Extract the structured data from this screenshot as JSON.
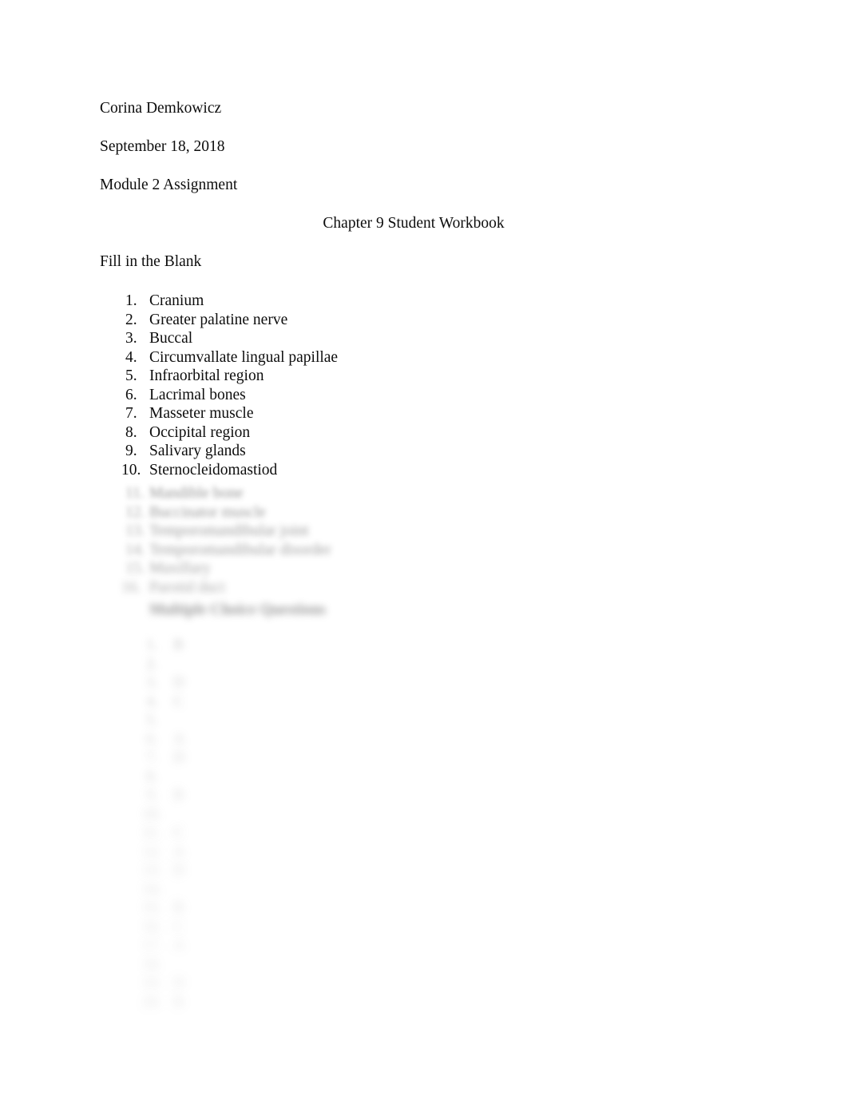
{
  "document": {
    "author": "Corina Demkowicz",
    "date": "September 18, 2018",
    "assignment": "Module 2 Assignment",
    "title": "Chapter 9 Student Workbook"
  },
  "sections": {
    "fill_in_the_blank": {
      "heading": "Fill in the Blank",
      "answers": [
        {
          "num": "1.",
          "text": "Cranium"
        },
        {
          "num": "2.",
          "text": "Greater palatine nerve"
        },
        {
          "num": "3.",
          "text": "Buccal"
        },
        {
          "num": "4.",
          "text": "Circumvallate lingual papillae"
        },
        {
          "num": "5.",
          "text": "Infraorbital region"
        },
        {
          "num": "6.",
          "text": "Lacrimal bones"
        },
        {
          "num": "7.",
          "text": "Masseter muscle"
        },
        {
          "num": "8.",
          "text": "Occipital region"
        },
        {
          "num": "9.",
          "text": "Salivary glands"
        },
        {
          "num": "10.",
          "text": "Sternocleidomastiod"
        }
      ],
      "redacted_answers": [
        {
          "num": "11.",
          "text": "Mandible bone"
        },
        {
          "num": "12.",
          "text": "Buccinator muscle"
        },
        {
          "num": "13.",
          "text": "Temporomandibular joint"
        },
        {
          "num": "14.",
          "text": "Temporomandibular disorder"
        },
        {
          "num": "15.",
          "text": "Maxillary"
        },
        {
          "num": "16.",
          "text": "Parotid duct"
        }
      ]
    },
    "multiple_choice": {
      "heading": "Multiple Choice Questions",
      "redacted_answers": [
        {
          "num": "1.",
          "text": "B"
        },
        {
          "num": "2.",
          "text": ""
        },
        {
          "num": "3.",
          "text": "D"
        },
        {
          "num": "4.",
          "text": "C"
        },
        {
          "num": "5.",
          "text": ""
        },
        {
          "num": "6.",
          "text": "A"
        },
        {
          "num": "7.",
          "text": "D"
        },
        {
          "num": "8.",
          "text": ""
        },
        {
          "num": "9.",
          "text": "B"
        },
        {
          "num": "10.",
          "text": ""
        },
        {
          "num": "11.",
          "text": "C"
        },
        {
          "num": "12.",
          "text": "A"
        },
        {
          "num": "13.",
          "text": "D"
        },
        {
          "num": "14.",
          "text": ""
        },
        {
          "num": "15.",
          "text": "B"
        },
        {
          "num": "16.",
          "text": "C"
        },
        {
          "num": "17.",
          "text": "A"
        },
        {
          "num": "18.",
          "text": ""
        },
        {
          "num": "19.",
          "text": "D"
        },
        {
          "num": "20.",
          "text": "B"
        }
      ]
    }
  }
}
